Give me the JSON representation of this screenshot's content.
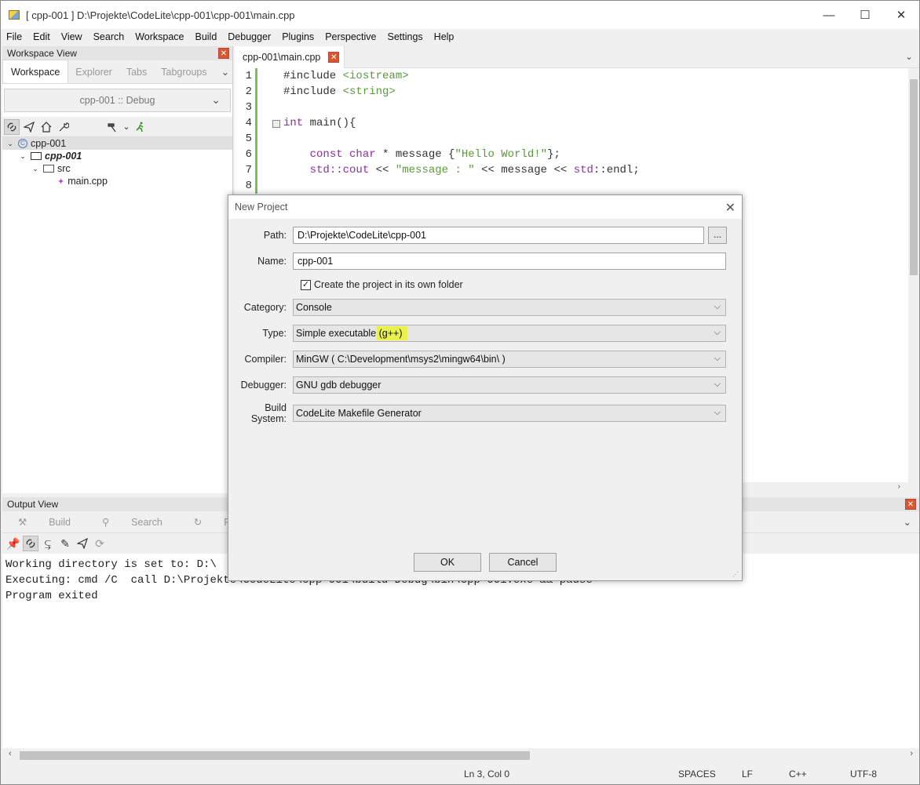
{
  "window": {
    "title": "[ cpp-001 ] D:\\Projekte\\CodeLite\\cpp-001\\cpp-001\\main.cpp",
    "minimize": "—",
    "maximize": "☐",
    "close": "✕"
  },
  "menu": [
    "File",
    "Edit",
    "View",
    "Search",
    "Workspace",
    "Build",
    "Debugger",
    "Plugins",
    "Perspective",
    "Settings",
    "Help"
  ],
  "workspace": {
    "header": "Workspace View",
    "tabs": [
      "Workspace",
      "Explorer",
      "Tabs",
      "Tabgroups"
    ],
    "config": "cpp-001 :: Debug",
    "tree": {
      "root": "cpp-001",
      "project": "cpp-001",
      "folder": "src",
      "file": "main.cpp"
    }
  },
  "editor": {
    "tab": "cpp-001\\main.cpp",
    "line_numbers": [
      "1",
      "2",
      "3",
      "4",
      "5",
      "6",
      "7",
      "8"
    ],
    "code": {
      "l1a": "#include ",
      "l1b": "<iostream>",
      "l2a": "#include ",
      "l2b": "<string>",
      "l4a": "int",
      "l4b": " main(){",
      "l6a": "    ",
      "l6b": "const char",
      "l6c": " * message {",
      "l6d": "\"Hello World!\"",
      "l6e": "};",
      "l7a": "    ",
      "l7b": "std::cout",
      "l7c": " << ",
      "l7d": "\"message : \"",
      "l7e": " << message << ",
      "l7f": "std",
      "l7g": "::endl;"
    }
  },
  "output": {
    "header": "Output View",
    "tabs": [
      "Build",
      "Search",
      "Replace",
      "Re"
    ],
    "lines": [
      "Working directory is set to: D:\\",
      "Executing: cmd /C  call D:\\Projekte\\CodeLite\\cpp-001\\build-Debug\\bin\\cpp-001.exe && pause",
      "Program exited"
    ]
  },
  "status": {
    "position": "Ln 3, Col 0",
    "indent": "SPACES",
    "eol": "LF",
    "lang": "C++",
    "encoding": "UTF-8"
  },
  "dialog": {
    "title": "New Project",
    "path_label": "Path:",
    "path_value": "D:\\Projekte\\CodeLite\\cpp-001",
    "browse": "...",
    "name_label": "Name:",
    "name_value": "cpp-001",
    "own_folder_label": "Create the project in its own folder",
    "own_folder_checked": true,
    "category_label": "Category:",
    "category_value": "Console",
    "type_label": "Type:",
    "type_value_a": "Simple executable ",
    "type_value_b": "(g++)",
    "compiler_label": "Compiler:",
    "compiler_value": "MinGW ( C:\\Development\\msys2\\mingw64\\bin\\ )",
    "debugger_label": "Debugger:",
    "debugger_value": "GNU gdb debugger",
    "build_label": "Build System:",
    "build_value": "CodeLite Makefile Generator",
    "ok": "OK",
    "cancel": "Cancel",
    "highlight_color": "#e9f24a"
  }
}
